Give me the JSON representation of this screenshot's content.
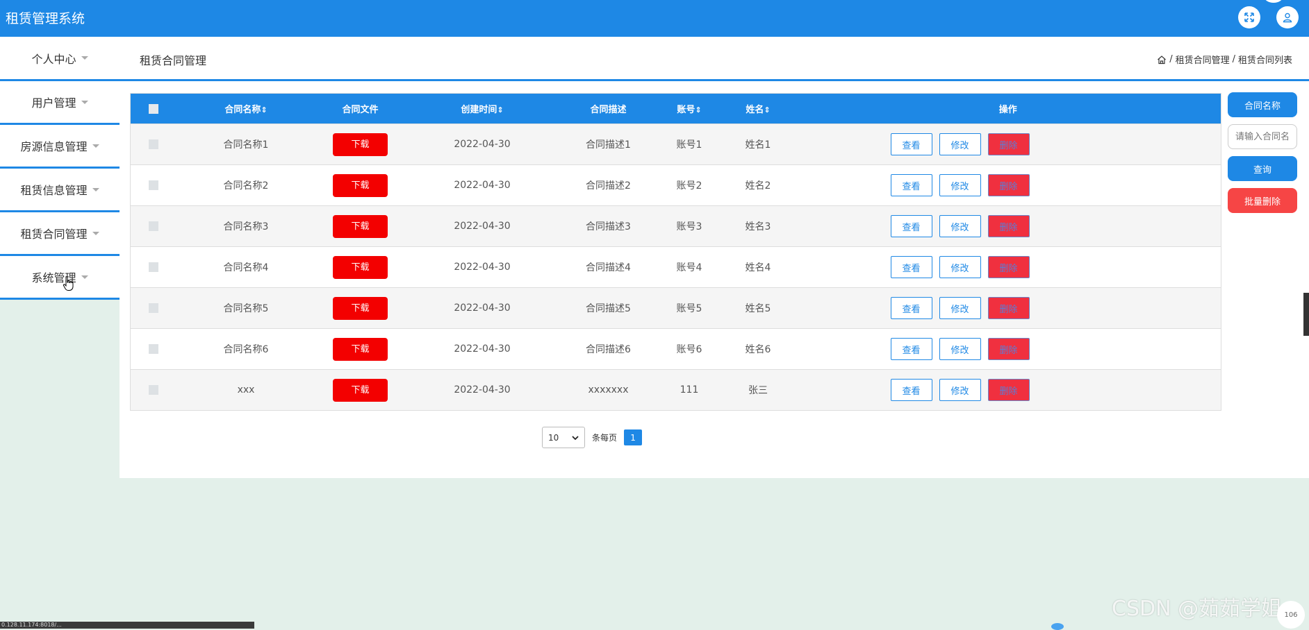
{
  "app": {
    "title": "租赁管理系统"
  },
  "topbar": {
    "menu_label": "个人中心",
    "page_title": "租赁合同管理",
    "breadcrumb": [
      "租赁合同管理",
      "租赁合同列表"
    ],
    "breadcrumb_sep": "/"
  },
  "sidebar": {
    "items": [
      {
        "label": "用户管理"
      },
      {
        "label": "房源信息管理"
      },
      {
        "label": "租赁信息管理"
      },
      {
        "label": "租赁合同管理"
      },
      {
        "label": "系统管理"
      }
    ]
  },
  "table": {
    "headers": {
      "name": "合同名称",
      "file": "合同文件",
      "created": "创建时间",
      "desc": "合同描述",
      "account": "账号",
      "person": "姓名",
      "ops": "操作"
    },
    "sort_glyph": "⇕",
    "download_label": "下载",
    "view_label": "查看",
    "edit_label": "修改",
    "delete_label": "删除",
    "rows": [
      {
        "name": "合同名称1",
        "created": "2022-04-30",
        "desc": "合同描述1",
        "account": "账号1",
        "person": "姓名1"
      },
      {
        "name": "合同名称2",
        "created": "2022-04-30",
        "desc": "合同描述2",
        "account": "账号2",
        "person": "姓名2"
      },
      {
        "name": "合同名称3",
        "created": "2022-04-30",
        "desc": "合同描述3",
        "account": "账号3",
        "person": "姓名3"
      },
      {
        "name": "合同名称4",
        "created": "2022-04-30",
        "desc": "合同描述4",
        "account": "账号4",
        "person": "姓名4"
      },
      {
        "name": "合同名称5",
        "created": "2022-04-30",
        "desc": "合同描述5",
        "account": "账号5",
        "person": "姓名5"
      },
      {
        "name": "合同名称6",
        "created": "2022-04-30",
        "desc": "合同描述6",
        "account": "账号6",
        "person": "姓名6"
      },
      {
        "name": "xxx",
        "created": "2022-04-30",
        "desc": "xxxxxxx",
        "account": "111",
        "person": "张三"
      }
    ]
  },
  "pagination": {
    "page_size": "10",
    "per_page_label": "条每页",
    "current_page": "1"
  },
  "search": {
    "label": "合同名称",
    "placeholder": "请输入合同名称",
    "query_label": "查询",
    "bulk_delete_label": "批量删除"
  },
  "overlay": {
    "status_url": "0.128.11.174:8018/...",
    "watermark": "CSDN @茹茹学姐",
    "corner_badge": "106"
  }
}
